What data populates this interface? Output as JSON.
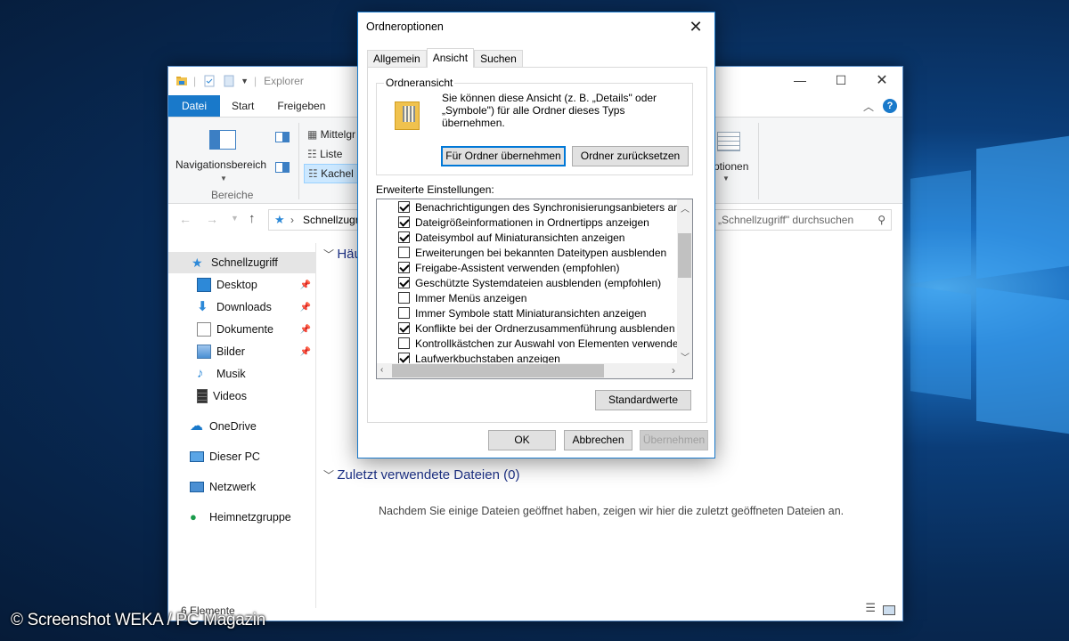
{
  "explorer": {
    "title": "Explorer",
    "ribbon_tabs": [
      "Datei",
      "Start",
      "Freigeben"
    ],
    "layout_options": [
      "Mittelgr",
      "Liste",
      "Kachel"
    ],
    "nav_pane_label": "Navigationsbereich",
    "group_label": "Bereiche",
    "options_label": "ptionen",
    "address": "Schnellzugriff",
    "search_placeholder": "„Schnellzugriff\" durchsuchen",
    "nav_items": [
      {
        "label": "Schnellzugriff",
        "icon": "star-icon"
      },
      {
        "label": "Desktop",
        "icon": "desktop-icon",
        "pinned": true
      },
      {
        "label": "Downloads",
        "icon": "download-icon",
        "pinned": true
      },
      {
        "label": "Dokumente",
        "icon": "document-icon",
        "pinned": true
      },
      {
        "label": "Bilder",
        "icon": "pictures-icon",
        "pinned": true
      },
      {
        "label": "Musik",
        "icon": "music-icon"
      },
      {
        "label": "Videos",
        "icon": "video-icon"
      },
      {
        "label": "OneDrive",
        "icon": "cloud-icon"
      },
      {
        "label": "Dieser PC",
        "icon": "computer-icon"
      },
      {
        "label": "Netzwerk",
        "icon": "network-icon"
      },
      {
        "label": "Heimnetzgruppe",
        "icon": "homegroup-icon"
      }
    ],
    "frequent_header": "Häu",
    "recent_header": "Zuletzt verwendete Dateien (0)",
    "recent_empty_text": "Nachdem Sie einige Dateien geöffnet haben, zeigen wir hier die zuletzt geöffneten Dateien an.",
    "status": "6 Elemente"
  },
  "dialog": {
    "title": "Ordneroptionen",
    "tabs": [
      "Allgemein",
      "Ansicht",
      "Suchen"
    ],
    "active_tab": "Ansicht",
    "folder_view_legend": "Ordneransicht",
    "folder_view_text": "Sie können diese Ansicht (z. B. „Details\" oder „Symbole\") für alle Ordner dieses Typs übernehmen.",
    "apply_button": "Für Ordner übernehmen",
    "reset_button": "Ordner zurücksetzen",
    "advanced_label": "Erweiterte Einstellungen:",
    "options": [
      {
        "label": "Benachrichtigungen des Synchronisierungsanbieters anzeig",
        "checked": true
      },
      {
        "label": "Dateigrößeinformationen in Ordnertipps anzeigen",
        "checked": true
      },
      {
        "label": "Dateisymbol auf Miniaturansichten anzeigen",
        "checked": true
      },
      {
        "label": "Erweiterungen bei bekannten Dateitypen ausblenden",
        "checked": false
      },
      {
        "label": "Freigabe-Assistent verwenden (empfohlen)",
        "checked": true
      },
      {
        "label": "Geschützte Systemdateien ausblenden (empfohlen)",
        "checked": true
      },
      {
        "label": "Immer Menüs anzeigen",
        "checked": false
      },
      {
        "label": "Immer Symbole statt Miniaturansichten anzeigen",
        "checked": false
      },
      {
        "label": "Konflikte bei der Ordnerzusammenführung ausblenden",
        "checked": true
      },
      {
        "label": "Kontrollkästchen zur Auswahl von Elementen verwenden",
        "checked": false
      },
      {
        "label": "Laufwerkbuchstaben anzeigen",
        "checked": true
      }
    ],
    "defaults_button": "Standardwerte",
    "ok_button": "OK",
    "cancel_button": "Abbrechen",
    "apply_all_button": "Übernehmen"
  },
  "watermark": "© Screenshot WEKA / PC Magazin",
  "colors": {
    "accent": "#1979ca",
    "link_header": "#1e3287"
  }
}
